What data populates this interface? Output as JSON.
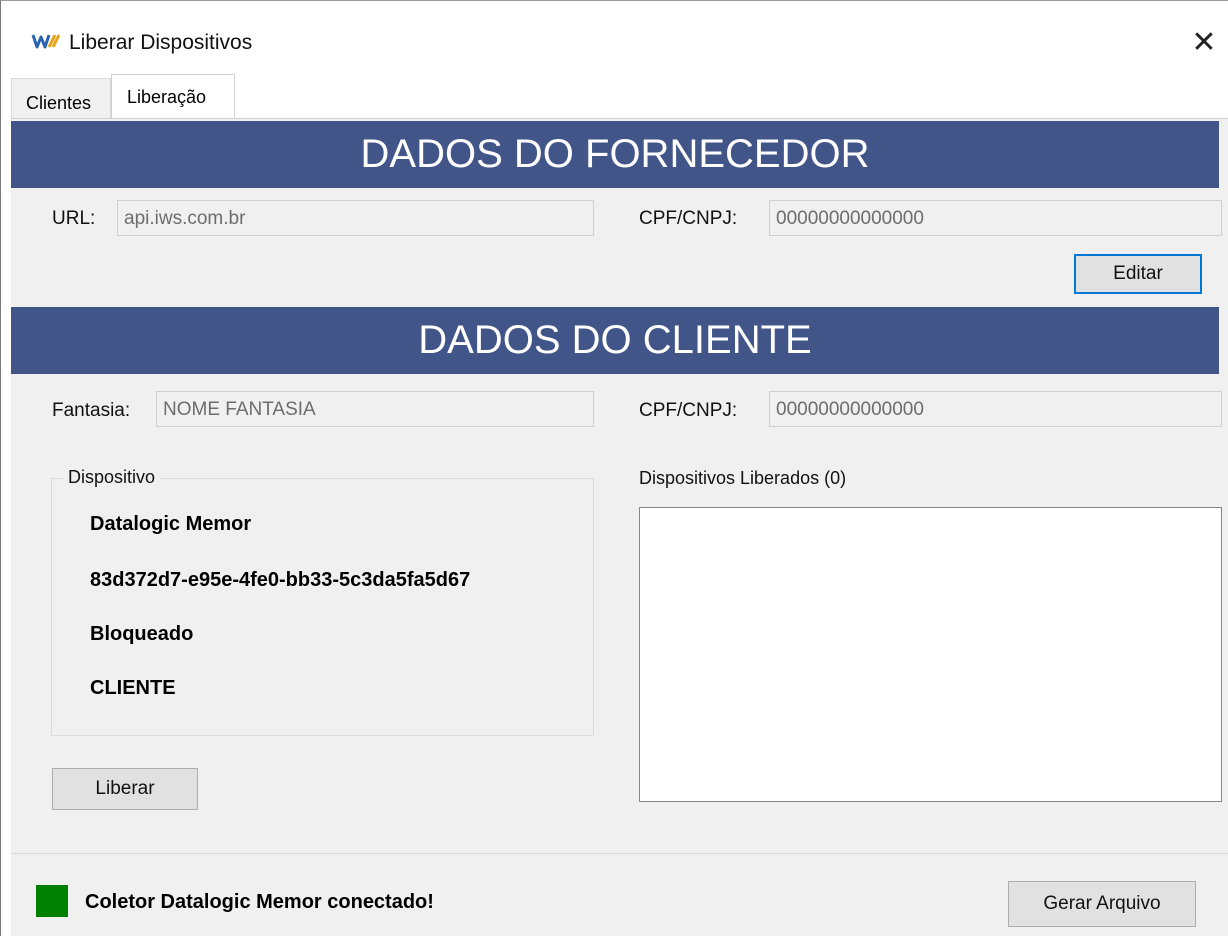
{
  "window": {
    "title": "Liberar Dispositivos",
    "close_glyph": "✕"
  },
  "tabs": [
    {
      "label": "Clientes",
      "active": false
    },
    {
      "label": "Liberação",
      "active": true
    }
  ],
  "fornecedor": {
    "header": "DADOS DO FORNECEDOR",
    "url_label": "URL:",
    "url_value": "api.iws.com.br",
    "cpf_label": "CPF/CNPJ:",
    "cpf_value": "00000000000000",
    "edit_button": "Editar"
  },
  "cliente": {
    "header": "DADOS DO CLIENTE",
    "fantasia_label": "Fantasia:",
    "fantasia_value": "NOME FANTASIA",
    "cpf_label": "CPF/CNPJ:",
    "cpf_value": "00000000000000"
  },
  "dispositivo": {
    "group_title": "Dispositivo",
    "name": "Datalogic Memor",
    "id": "83d372d7-e95e-4fe0-bb33-5c3da5fa5d67",
    "status": "Bloqueado",
    "type": "CLIENTE",
    "release_button": "Liberar"
  },
  "liberados": {
    "label": "Dispositivos Liberados (0)",
    "items": []
  },
  "status": {
    "text": "Coletor Datalogic Memor conectado!",
    "indicator_color": "#008000"
  },
  "footer": {
    "generate_button": "Gerar Arquivo"
  },
  "colors": {
    "header_bg": "#425589",
    "app_icon": "#e8a21a"
  }
}
